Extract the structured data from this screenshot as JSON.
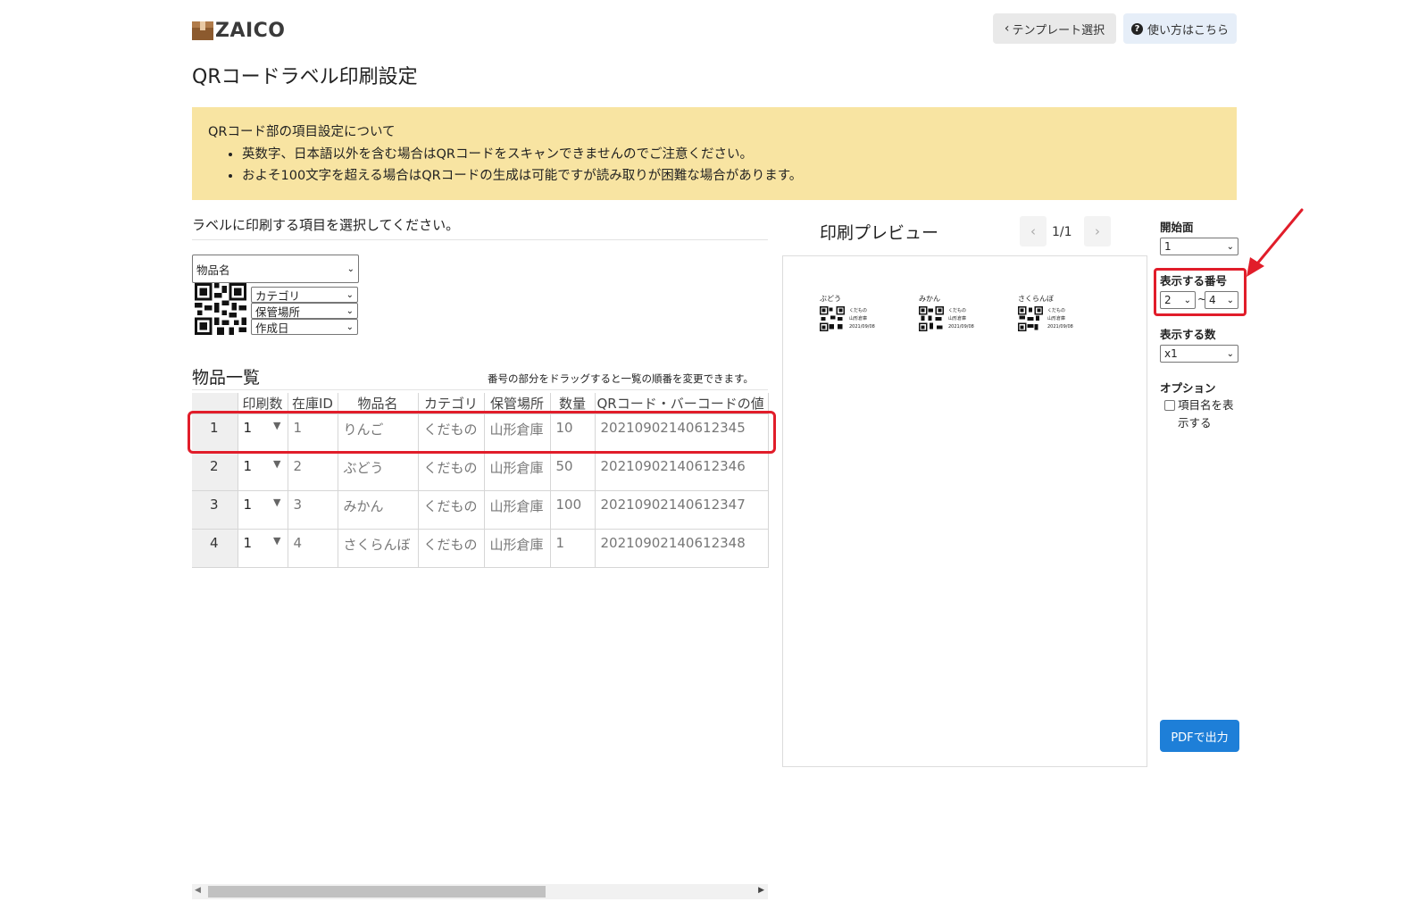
{
  "header": {
    "logo_text": "ZAICO",
    "template_button": "テンプレート選択",
    "help_button": "使い方はこちら"
  },
  "page_title": "QRコードラベル印刷設定",
  "notice": {
    "title": "QRコード部の項目設定について",
    "items": [
      "英数字、日本語以外を含む場合はQRコードをスキャンできませんのでご注意ください。",
      "およそ100文字を超える場合はQRコードの生成は可能ですが読み取りが困難な場合があります。"
    ]
  },
  "field_select": {
    "instruction": "ラベルに印刷する項目を選択してください。",
    "name_field": "物品名",
    "fields": [
      "カテゴリ",
      "保管場所",
      "作成日"
    ]
  },
  "item_list": {
    "title": "物品一覧",
    "hint": "番号の部分をドラッグすると一覧の順番を変更できます。",
    "columns": [
      "",
      "印刷数",
      "在庫ID",
      "物品名",
      "カテゴリ",
      "保管場所",
      "数量",
      "QRコード・バーコードの値"
    ],
    "rows": [
      {
        "no": "1",
        "print_count": "1",
        "stock_id": "1",
        "name": "りんご",
        "category": "くだもの",
        "location": "山形倉庫",
        "quantity": "10",
        "code": "20210902140612345"
      },
      {
        "no": "2",
        "print_count": "1",
        "stock_id": "2",
        "name": "ぶどう",
        "category": "くだもの",
        "location": "山形倉庫",
        "quantity": "50",
        "code": "20210902140612346"
      },
      {
        "no": "3",
        "print_count": "1",
        "stock_id": "3",
        "name": "みかん",
        "category": "くだもの",
        "location": "山形倉庫",
        "quantity": "100",
        "code": "20210902140612347"
      },
      {
        "no": "4",
        "print_count": "1",
        "stock_id": "4",
        "name": "さくらんぼ",
        "category": "くだもの",
        "location": "山形倉庫",
        "quantity": "1",
        "code": "20210902140612348"
      }
    ]
  },
  "preview": {
    "title": "印刷プレビュー",
    "page_indicator": "1/1",
    "labels": [
      {
        "name": "ぶどう",
        "category": "くだもの",
        "location": "山形倉庫",
        "date": "2021/09/08"
      },
      {
        "name": "みかん",
        "category": "くだもの",
        "location": "山形倉庫",
        "date": "2021/09/08"
      },
      {
        "name": "さくらんぼ",
        "category": "くだもの",
        "location": "山形倉庫",
        "date": "2021/09/08"
      }
    ]
  },
  "sidebar": {
    "start_label": "開始面",
    "start_value": "1",
    "number_label": "表示する番号",
    "number_from": "2",
    "number_tilde": "~",
    "number_to": "4",
    "count_label": "表示する数",
    "count_value": "x1",
    "option_label": "オプション",
    "option_show_names": "項目名を表示する",
    "pdf_button": "PDFで出力"
  },
  "colors": {
    "notice_bg": "#f8e4a2",
    "accent_blue": "#1e7fd8",
    "highlight_red": "#e11d2a"
  }
}
